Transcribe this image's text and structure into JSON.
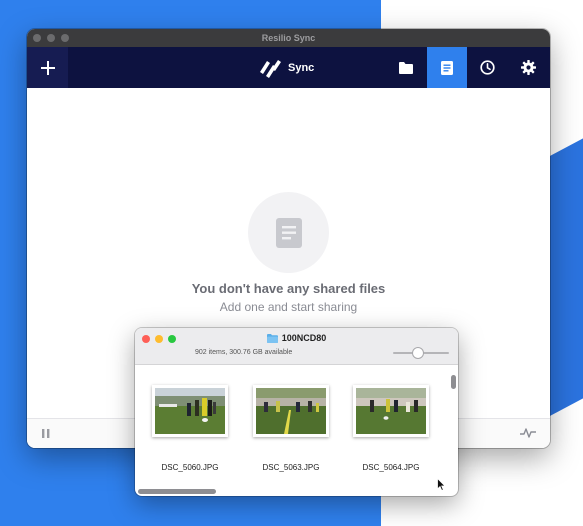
{
  "resilio": {
    "window_title": "Resilio Sync",
    "logo_text": "Sync",
    "toolbar": {
      "add_icon": "plus-icon",
      "folder_icon": "folder-icon",
      "files_icon": "document-icon",
      "history_icon": "clock-icon",
      "settings_icon": "gear-icon",
      "active_tab": "files"
    },
    "empty_state": {
      "title": "You don't have any shared files",
      "subtitle": "Add one and start sharing"
    },
    "statusbar": {
      "pause_icon": "pause-icon",
      "activity_icon": "activity-icon"
    },
    "colors": {
      "toolbar_bg": "#0d1240",
      "accent": "#2f80ed"
    }
  },
  "finder": {
    "title": "100NCD80",
    "info": "902 items, 300.76 GB available",
    "files": [
      {
        "name": "DSC_5060.JPG"
      },
      {
        "name": "DSC_5063.JPG"
      },
      {
        "name": "DSC_5064.JPG"
      }
    ]
  }
}
